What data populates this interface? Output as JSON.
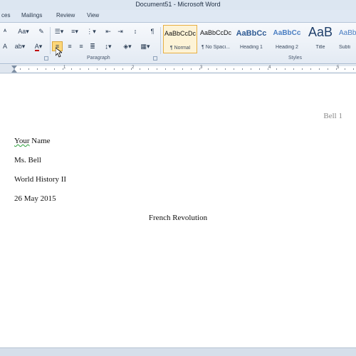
{
  "window": {
    "title": "Document51 - Microsoft Word"
  },
  "tabs": [
    {
      "label": "ces"
    },
    {
      "label": "Mailings"
    },
    {
      "label": "Review"
    },
    {
      "label": "View"
    }
  ],
  "ribbon": {
    "paragraph_label": "Paragraph",
    "styles_label": "Styles",
    "font_size_icon": "A",
    "styles": [
      {
        "sample": "AaBbCcDc",
        "name": "¶ Normal",
        "active": true
      },
      {
        "sample": "AaBbCcDc",
        "name": "¶ No Spaci...",
        "active": false
      },
      {
        "sample": "AaBbCc",
        "name": "Heading 1",
        "active": false
      },
      {
        "sample": "AaBbCc",
        "name": "Heading 2",
        "active": false
      },
      {
        "sample": "AaB",
        "name": "Title",
        "active": false
      },
      {
        "sample": "AaBb",
        "name": "Subti",
        "active": false
      }
    ]
  },
  "ruler": {
    "numbers": [
      "1",
      "2",
      "3",
      "4",
      "5"
    ]
  },
  "document": {
    "header": "Bell 1",
    "lines": [
      "Your Name",
      "Ms. Bell",
      "World History II",
      "26 May 2015"
    ],
    "name_underlined_word": "Your",
    "name_rest": " Name",
    "title": "French Revolution"
  },
  "colors": {
    "accent": "#e8b042",
    "active_align_bg": "#fcd77a",
    "header_text": "#8a8a8a"
  }
}
